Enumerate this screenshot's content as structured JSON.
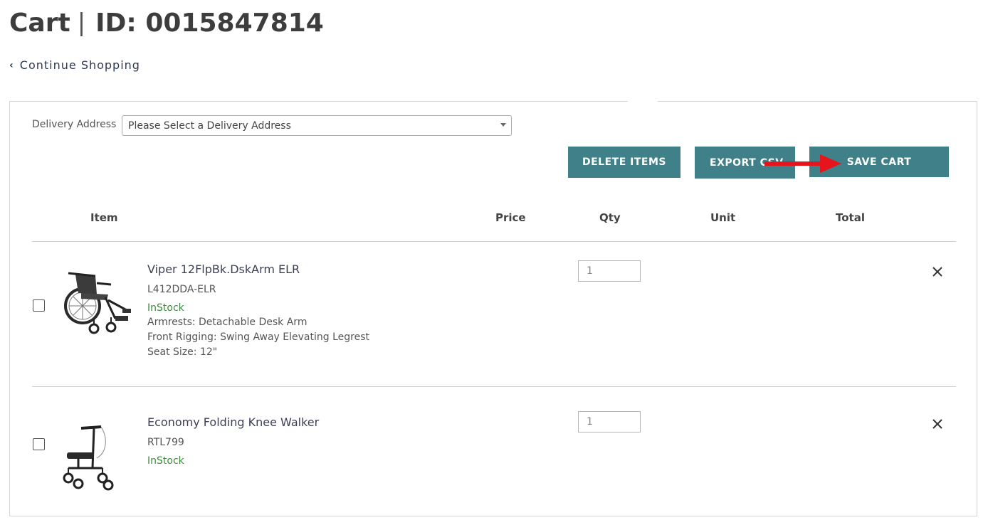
{
  "header": {
    "cart_label": "Cart",
    "separator": "|",
    "cart_id": "ID: 0015847814",
    "continue_shopping": "Continue Shopping"
  },
  "delivery": {
    "label": "Delivery Address",
    "selected": "Please Select a Delivery Address"
  },
  "actions": {
    "delete_items": "DELETE ITEMS",
    "export_csv": "EXPORT CSV",
    "save_cart": "SAVE CART"
  },
  "table": {
    "columns": [
      "Item",
      "Price",
      "Qty",
      "Unit",
      "Total"
    ],
    "rows": [
      {
        "name": "Viper 12FlpBk.DskArm ELR",
        "sku": "L412DDA-ELR",
        "stock": "InStock",
        "attributes": [
          "Armrests: Detachable Desk Arm",
          "Front Rigging: Swing Away Elevating Legrest",
          "Seat Size: 12\""
        ],
        "qty": "1",
        "image": "wheelchair"
      },
      {
        "name": "Economy Folding Knee Walker",
        "sku": "RTL799",
        "stock": "InStock",
        "attributes": [],
        "qty": "1",
        "image": "knee-walker"
      }
    ]
  },
  "colors": {
    "button_bg": "#3f8089",
    "in_stock": "#3e8a3e",
    "annotation_arrow": "#e8141b"
  }
}
